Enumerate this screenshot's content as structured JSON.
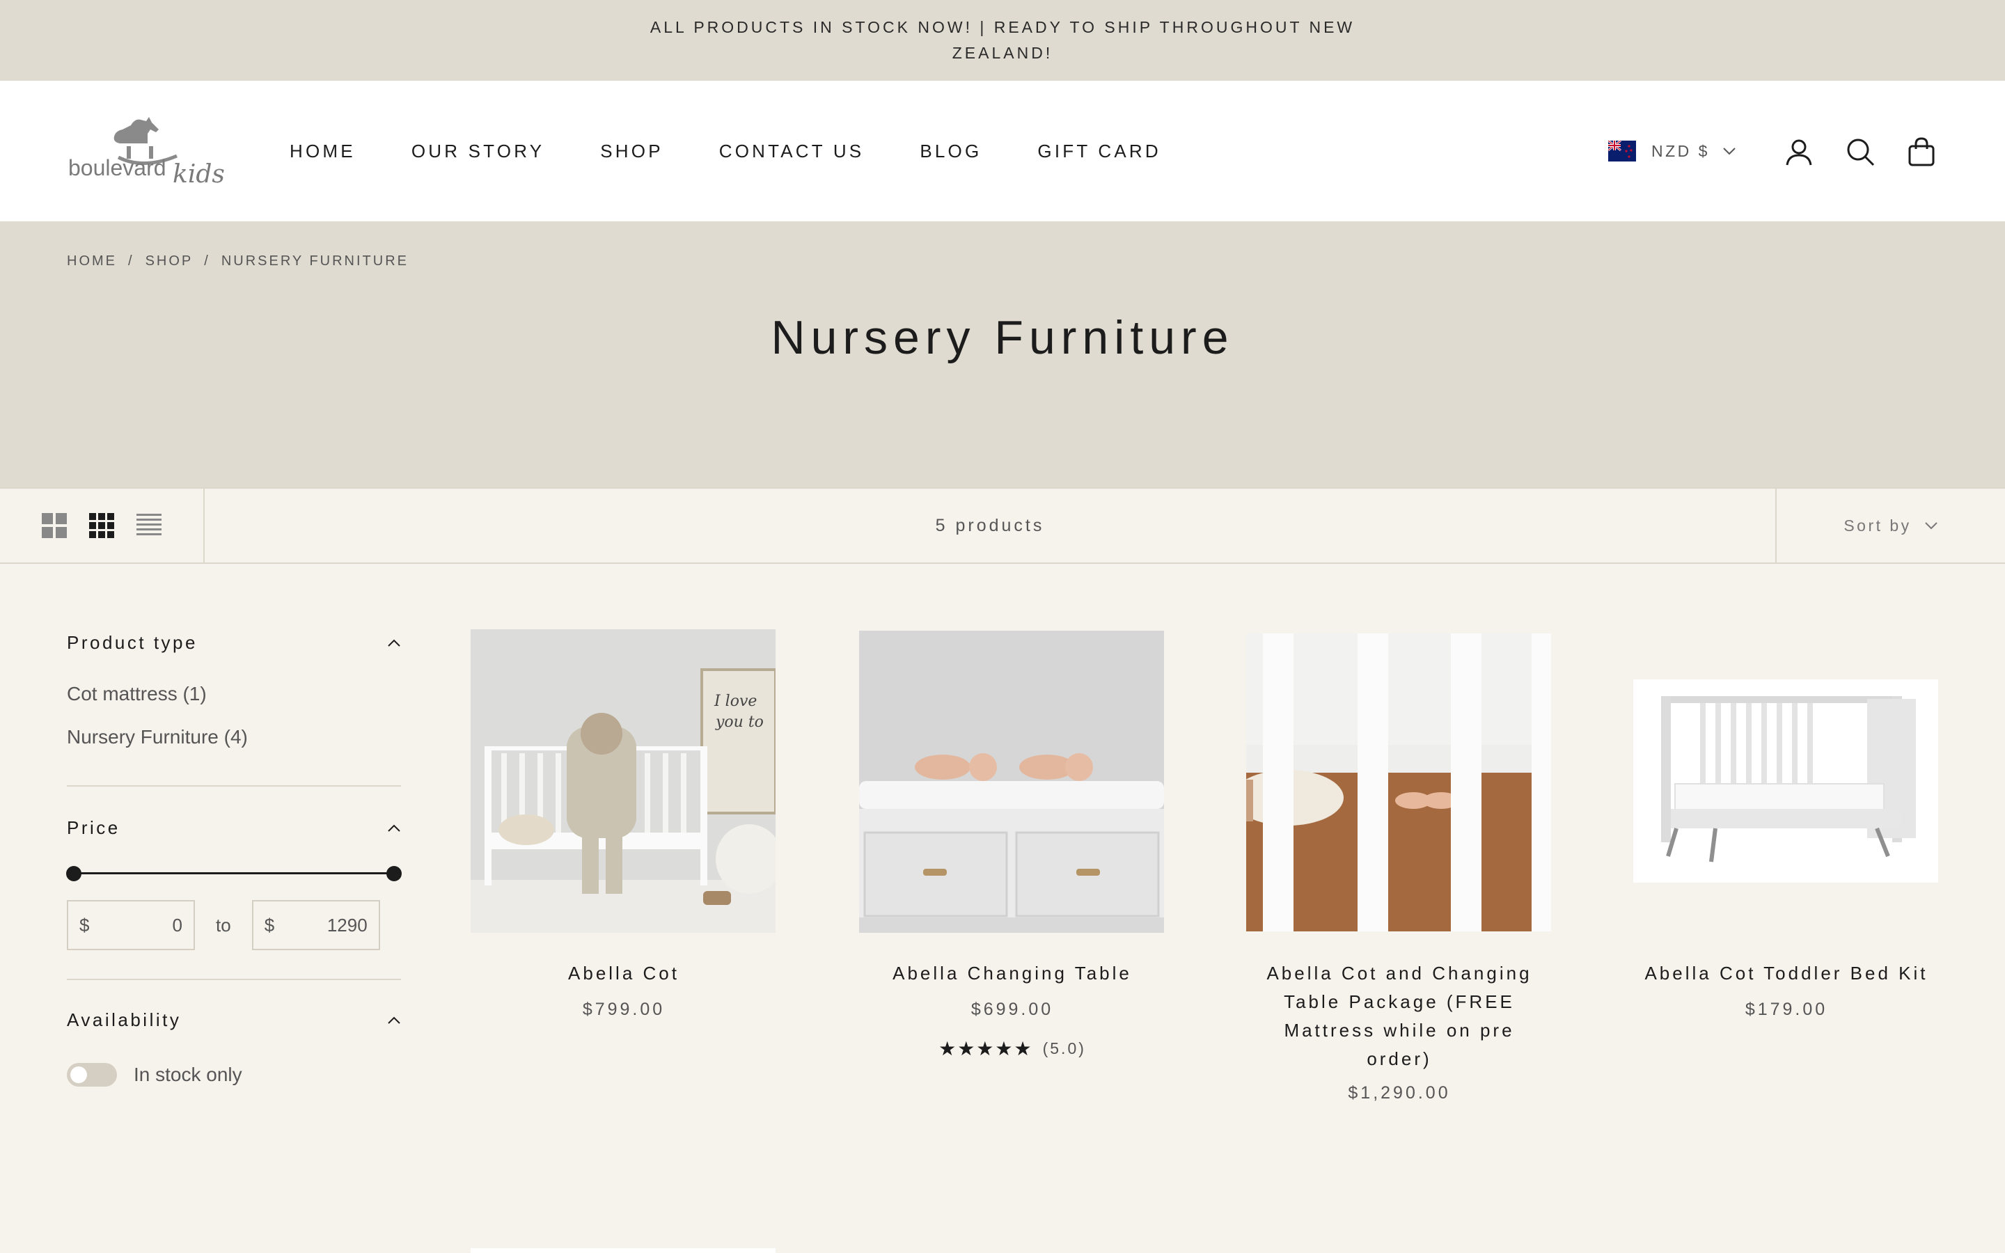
{
  "announcement": "ALL PRODUCTS IN STOCK NOW! | READY TO SHIP THROUGHOUT NEW ZEALAND!",
  "header": {
    "logo": {
      "text_main": "boulevard",
      "text_script": "kids"
    },
    "nav": [
      "HOME",
      "OUR STORY",
      "SHOP",
      "CONTACT US",
      "BLOG",
      "GIFT CARD"
    ],
    "currency": "NZD $",
    "icons": [
      "account-icon",
      "search-icon",
      "cart-icon"
    ]
  },
  "breadcrumb": [
    "HOME",
    "SHOP",
    "NURSERY FURNITURE"
  ],
  "page_title": "Nursery Furniture",
  "toolbar": {
    "layout_options": [
      "grid-large-icon",
      "grid-small-icon",
      "list-icon"
    ],
    "product_count": "5 products",
    "sort_label": "Sort by"
  },
  "filters": {
    "product_type": {
      "title": "Product type",
      "options": [
        "Cot mattress (1)",
        "Nursery Furniture (4)"
      ]
    },
    "price": {
      "title": "Price",
      "currency": "$",
      "min": "0",
      "to": "to",
      "max": "1290"
    },
    "availability": {
      "title": "Availability",
      "toggle_label": "In stock only",
      "enabled": false
    }
  },
  "products": [
    {
      "name": "Abella Cot",
      "price": "$799.00"
    },
    {
      "name": "Abella Changing Table",
      "price": "$699.00",
      "rating_stars": "★★★★★",
      "rating": "(5.0)"
    },
    {
      "name_lines": [
        "Abella Cot and Changing",
        "Table Package (FREE",
        "Mattress while on pre",
        "order)"
      ],
      "price": "$1,290.00"
    },
    {
      "name": "Abella Cot Toddler Bed Kit",
      "price": "$179.00"
    }
  ],
  "colors": {
    "banner": "#e0dbd0",
    "page_bg": "#f6f2ec",
    "text": "#1c1c1c",
    "muted": "#555555"
  }
}
